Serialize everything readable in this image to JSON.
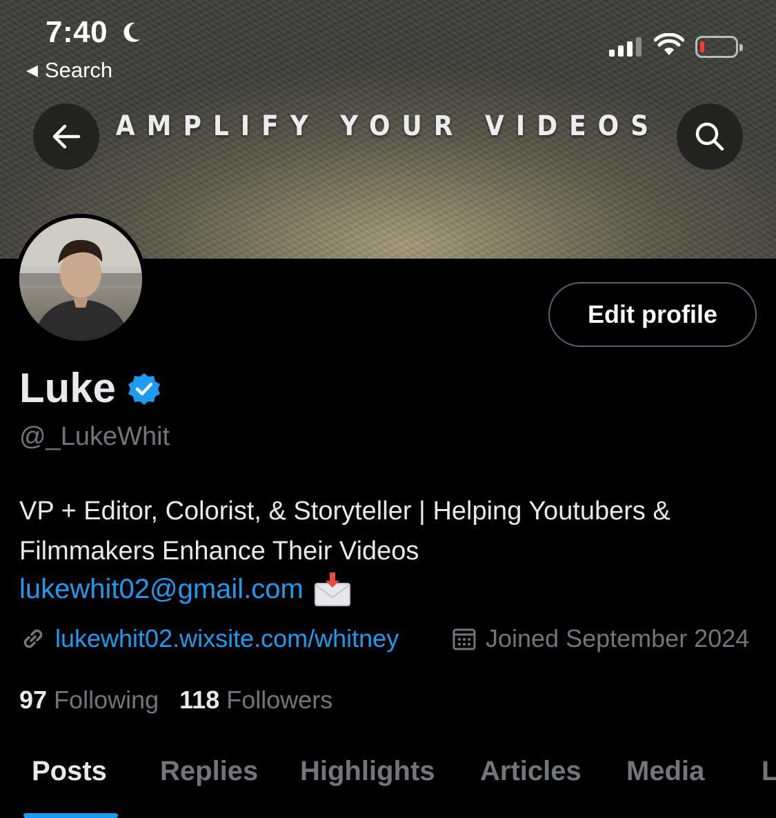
{
  "status_bar": {
    "time": "7:40",
    "back_label": "Search"
  },
  "banner": {
    "text": "AMPLIFY YOUR VIDEOS"
  },
  "profile": {
    "edit_button": "Edit profile",
    "name": "Luke",
    "handle": "@_LukeWhit",
    "bio": "VP + Editor, Colorist, & Storyteller | Helping Youtubers & Filmmakers Enhance Their Videos",
    "email": "lukewhit02@gmail.com",
    "website": "lukewhit02.wixsite.com/whitney",
    "joined": "Joined September 2024",
    "following_count": "97",
    "following_label": "Following",
    "followers_count": "118",
    "followers_label": "Followers"
  },
  "tabs": [
    {
      "label": "Posts",
      "active": true
    },
    {
      "label": "Replies"
    },
    {
      "label": "Highlights"
    },
    {
      "label": "Articles"
    },
    {
      "label": "Media"
    },
    {
      "label": "L"
    }
  ],
  "colors": {
    "accent": "#1d9bf0",
    "muted": "#71767b",
    "text": "#e7e9ea",
    "background": "#000000"
  }
}
